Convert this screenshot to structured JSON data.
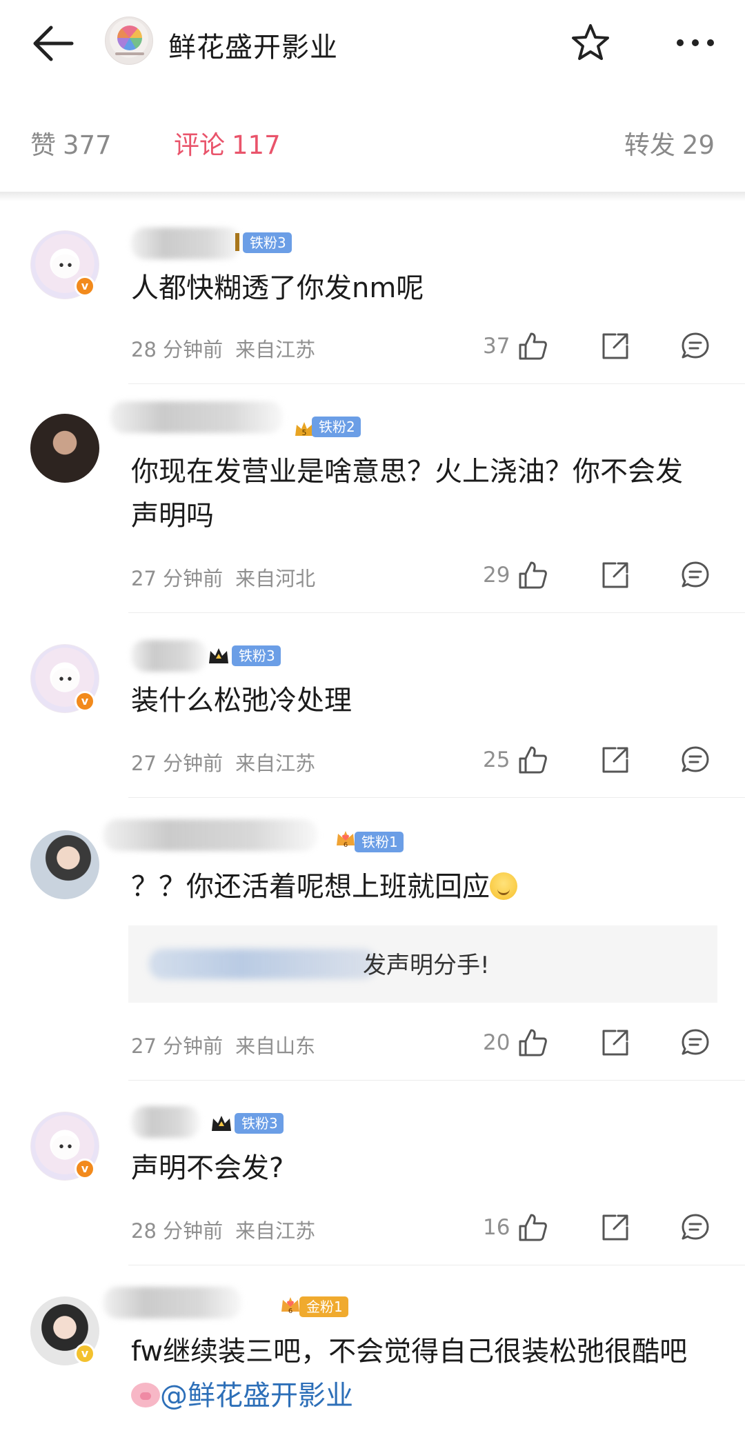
{
  "header": {
    "back_icon": "arrow-left-icon",
    "title": "鲜花盛开影业",
    "star_icon": "star-icon",
    "more_icon": "more-horizontal-icon"
  },
  "tabs": {
    "like_label": "赞",
    "like_count": "377",
    "comment_label": "评论",
    "comment_count": "117",
    "repost_label": "转发",
    "repost_count": "29",
    "active_color": "#e9546b"
  },
  "comments": [
    {
      "fan_badge": "铁粉3",
      "text": "人都快糊透了你发nm呢",
      "time": "28 分钟前",
      "location": "来自江苏",
      "likes": "37"
    },
    {
      "fan_badge": "铁粉2",
      "text": "你现在发营业是啥意思？火上浇油？你不会发声明吗",
      "time": "27 分钟前",
      "location": "来自河北",
      "likes": "29"
    },
    {
      "fan_badge": "铁粉3",
      "text": "装什么松弛冷处理",
      "time": "27 分钟前",
      "location": "来自江苏",
      "likes": "25"
    },
    {
      "fan_badge": "铁粉1",
      "text": "？？你还活着呢想上班就回应",
      "reply_text": "发声明分手!",
      "time": "27 分钟前",
      "location": "来自山东",
      "likes": "20"
    },
    {
      "fan_badge": "铁粉3",
      "text": "声明不会发?",
      "time": "28 分钟前",
      "location": "来自江苏",
      "likes": "16"
    },
    {
      "fan_badge": "金粉1",
      "text": "fw继续装三吧，不会觉得自己很装松弛很酷吧",
      "mention": "@鲜花盛开影业"
    }
  ]
}
